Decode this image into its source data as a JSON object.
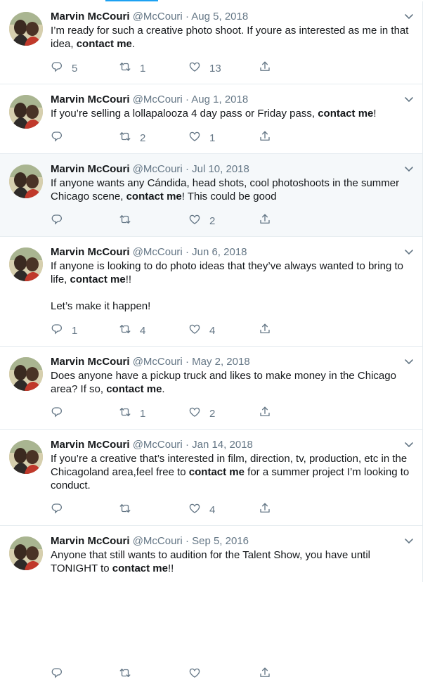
{
  "user": {
    "name": "Marvin McCouri",
    "handle": "@McCouri",
    "sep": "·"
  },
  "tweets": [
    {
      "date": "Aug 5, 2018",
      "pre": "I’m ready for such a creative photo shoot. If youre as interested as me in that idea, ",
      "bold": "contact me",
      "post": ".",
      "replies": "5",
      "retweets": "1",
      "likes": "13"
    },
    {
      "date": "Aug 1, 2018",
      "pre": "If you’re selling a lollapalooza 4 day pass or Friday pass, ",
      "bold": "contact me",
      "post": "!",
      "replies": "",
      "retweets": "2",
      "likes": "1"
    },
    {
      "date": "Jul 10, 2018",
      "pre": "If anyone wants any Cándida, head shots, cool photoshoots in the summer Chicago scene, ",
      "bold": "contact me",
      "post": "! This could be good",
      "replies": "",
      "retweets": "",
      "likes": "2"
    },
    {
      "date": "Jun 6, 2018",
      "pre": "If anyone is looking to do photo ideas that they’ve always wanted to bring to life, ",
      "bold": "contact me",
      "post": "!!\n\nLet’s make it happen!",
      "replies": "1",
      "retweets": "4",
      "likes": "4"
    },
    {
      "date": "May 2, 2018",
      "pre": "Does anyone have a pickup truck and likes to make money in the Chicago area? If so, ",
      "bold": "contact me",
      "post": ".",
      "replies": "",
      "retweets": "1",
      "likes": "2"
    },
    {
      "date": "Jan 14, 2018",
      "pre": "If you’re a creative that’s interested in film, direction, tv, production, etc in the Chicagoland area,feel free to ",
      "bold": "contact me",
      "post": " for a summer project I’m looking to conduct.",
      "replies": "",
      "retweets": "",
      "likes": "4"
    },
    {
      "date": "Sep 5, 2016",
      "pre": "Anyone that still wants to audition for the Talent Show, you have until TONIGHT to ",
      "bold": "contact me",
      "post": "!!",
      "replies": "",
      "retweets": "",
      "likes": ""
    }
  ],
  "icons": {
    "reply": "reply-icon",
    "retweet": "retweet-icon",
    "like": "heart-icon",
    "share": "share-icon",
    "menu": "chevron-down-icon"
  },
  "colors": {
    "accent": "#1da1f2",
    "muted": "#657786",
    "highlight": "#f5f8fa"
  }
}
